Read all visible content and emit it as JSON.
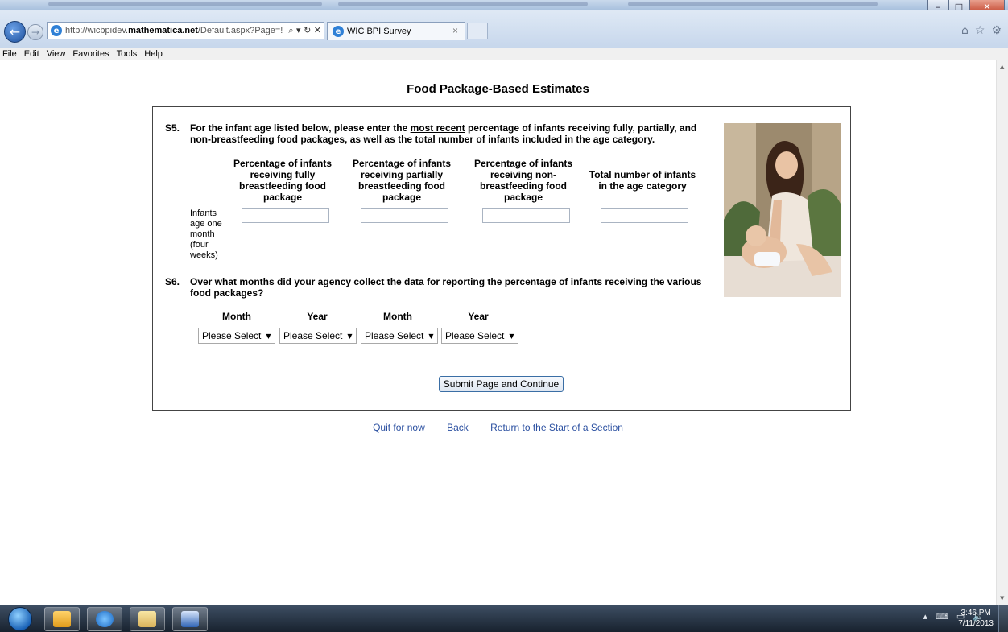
{
  "browser": {
    "url_prefix": "http://wicbpidev.",
    "url_domain": "mathematica.net",
    "url_path": "/Default.aspx?Page=!",
    "tab_title": "WIC BPI Survey"
  },
  "menu": [
    "File",
    "Edit",
    "View",
    "Favorites",
    "Tools",
    "Help"
  ],
  "page": {
    "heading": "Food Package-Based Estimates",
    "s5": {
      "number": "S5.",
      "text_before": "For the infant age listed below, please enter the ",
      "text_underlined": "most recent",
      "text_line1_after": " percentage of infants receiving fully, partially, and",
      "text_line2": "non-breastfeeding food packages, as well as the total number of infants included in the age category."
    },
    "table": {
      "columns": [
        "Percentage of infants receiving fully breastfeeding food package",
        "Percentage of infants receiving partially breastfeeding food package",
        "Percentage of infants receiving non-breastfeeding food package",
        "Total number of infants in the age category"
      ],
      "row_label": "Infants age one month (four weeks)"
    },
    "s6": {
      "number": "S6.",
      "text": "Over what months did your agency collect the data for reporting the percentage of infants receiving the various food packages?"
    },
    "date_headers": [
      "Month",
      "Year",
      "Month",
      "Year"
    ],
    "dropdown_value": "Please Select",
    "submit_label": "Submit Page and Continue",
    "links": [
      "Quit for now",
      "Back",
      "Return to the Start of a Section"
    ]
  },
  "taskbar": {
    "time": "3:46 PM",
    "date": "7/11/2013"
  }
}
